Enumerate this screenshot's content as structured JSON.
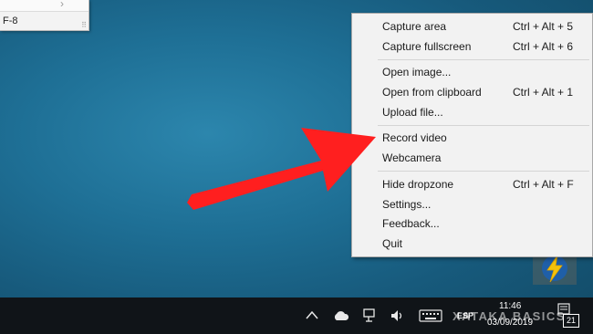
{
  "background_window": {
    "encoding_text": "F-8"
  },
  "context_menu": {
    "groups": [
      [
        {
          "label": "Capture area",
          "shortcut": "Ctrl + Alt + 5"
        },
        {
          "label": "Capture fullscreen",
          "shortcut": "Ctrl + Alt + 6"
        }
      ],
      [
        {
          "label": "Open image...",
          "shortcut": ""
        },
        {
          "label": "Open from clipboard",
          "shortcut": "Ctrl + Alt + 1"
        },
        {
          "label": "Upload file...",
          "shortcut": ""
        }
      ],
      [
        {
          "label": "Record video",
          "shortcut": ""
        },
        {
          "label": "Webcamera",
          "shortcut": ""
        }
      ],
      [
        {
          "label": "Hide dropzone",
          "shortcut": "Ctrl + Alt + F"
        },
        {
          "label": "Settings...",
          "shortcut": ""
        },
        {
          "label": "Feedback...",
          "shortcut": ""
        },
        {
          "label": "Quit",
          "shortcut": ""
        }
      ]
    ]
  },
  "annotation": {
    "arrow_color": "#ff1a1a",
    "points_to": "Record video"
  },
  "taskbar": {
    "language": "ESP",
    "time": "11:46",
    "date": "03/09/2019",
    "notification_count": "21",
    "icons": [
      "chevron-up-icon",
      "cloud-icon",
      "network-icon",
      "volume-icon",
      "keyboard-icon",
      "notification-icon"
    ]
  },
  "watermark": "XATAKA BASICS"
}
